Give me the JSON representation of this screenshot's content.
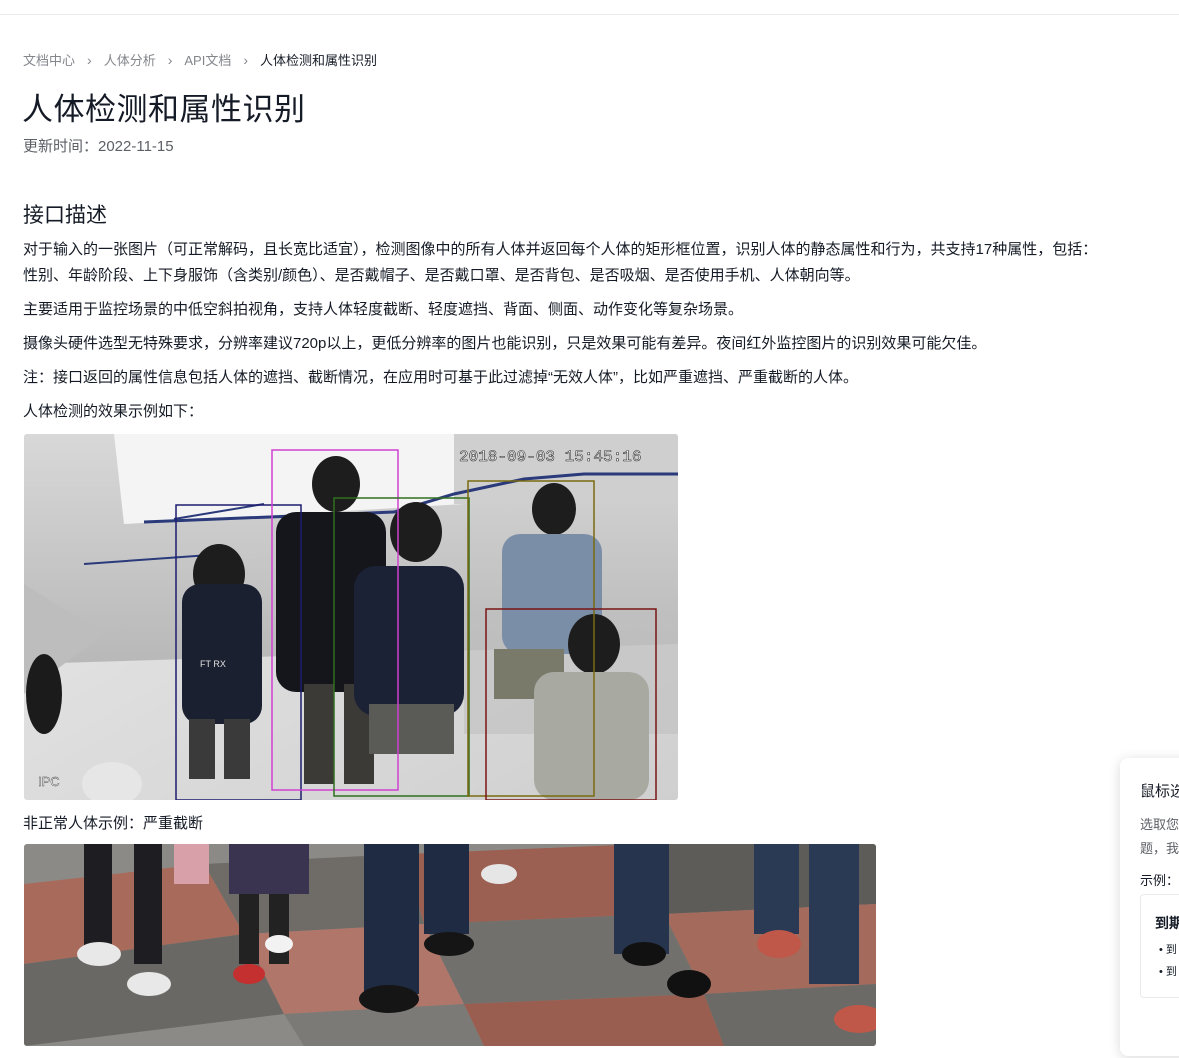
{
  "breadcrumb": {
    "items": [
      "文档中心",
      "人体分析",
      "API文档"
    ],
    "current": "人体检测和属性识别"
  },
  "page": {
    "title": "人体检测和属性识别",
    "updated": "更新时间：2022-11-15"
  },
  "section": {
    "title": "接口描述",
    "paragraphs": [
      "对于输入的一张图片（可正常解码，且长宽比适宜），检测图像中的所有人体并返回每个人体的矩形框位置，识别人体的静态属性和行为，共支持17种属性，包括：",
      "性别、年龄阶段、上下身服饰（含类别/颜色）、是否戴帽子、是否戴口罩、是否背包、是否吸烟、是否使用手机、人体朝向等。",
      "主要适用于监控场景的中低空斜拍视角，支持人体轻度截断、轻度遮挡、背面、侧面、动作变化等复杂场景。",
      "摄像头硬件选型无特殊要求，分辨率建议720p以上，更低分辨率的图片也能识别，只是效果可能有差异。夜间红外监控图片的识别效果可能欠佳。",
      "注：接口返回的属性信息包括人体的遮挡、截断情况，在应用时可基于此过滤掉“无效人体”，比如严重遮挡、严重截断的人体。",
      "人体检测的效果示例如下："
    ],
    "figure1": {
      "timestamp": "2018-09-03 15:45:16",
      "watermark": "IPC",
      "badge": "FT  RX"
    },
    "caption2": "非正常人体示例：严重截断"
  },
  "help_card": {
    "title": "鼠标选",
    "desc1": "选取您",
    "desc2": "题，我",
    "example_label": "示例：",
    "box_title": "到期",
    "box_item1": "到",
    "box_item2": "到"
  },
  "colors": {
    "text": "#151b26",
    "muted": "#84868c",
    "box_navy": "#1c1c6e",
    "box_magenta": "#d040d0",
    "box_green": "#2f6f1f",
    "box_olive": "#7a6a10",
    "box_maroon": "#7a1414"
  }
}
